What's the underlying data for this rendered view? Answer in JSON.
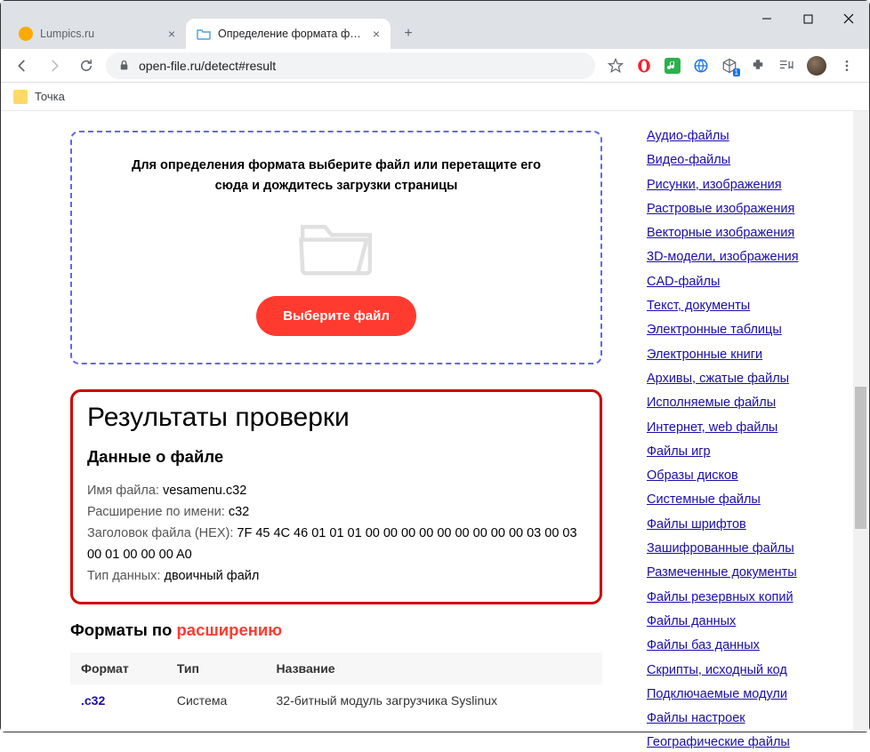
{
  "window": {
    "tabs": [
      {
        "title": "Lumpics.ru",
        "active": false
      },
      {
        "title": "Определение формата файла",
        "active": true
      }
    ],
    "url": "open-file.ru/detect#result"
  },
  "bookmarks": [
    {
      "label": "Точка"
    }
  ],
  "dropzone": {
    "message": "Для определения формата выберите файл или перетащите его сюда и дождитесь загрузки страницы",
    "button": "Выберите файл"
  },
  "results": {
    "heading": "Результаты проверки",
    "subheading": "Данные о файле",
    "rows": {
      "filename_label": "Имя файла: ",
      "filename_value": "vesamenu.c32",
      "ext_label": "Расширение по имени: ",
      "ext_value": "c32",
      "hex_label": "Заголовок файла (HEX): ",
      "hex_value": "7F 45 4C 46 01 01 01 00 00 00 00 00 00 00 00 00 03 00 03 00 01 00 00 00 A0",
      "type_label": "Тип данных: ",
      "type_value": "двоичный файл"
    }
  },
  "formats": {
    "heading_prefix": "Форматы по ",
    "heading_highlight": "расширению",
    "table": {
      "headers": {
        "format": "Формат",
        "type": "Тип",
        "name": "Название"
      },
      "row": {
        "format": ".c32",
        "type": "Система",
        "name": "32-битный модуль загрузчика Syslinux"
      }
    }
  },
  "sidebar_links": [
    "Аудио-файлы",
    "Видео-файлы",
    "Рисунки, изображения",
    "Растровые изображения",
    "Векторные изображения",
    "3D-модели, изображения",
    "CAD-файлы",
    "Текст, документы",
    "Электронные таблицы",
    "Электронные книги",
    "Архивы, сжатые файлы",
    "Исполняемые файлы",
    "Интернет, web файлы",
    "Файлы игр",
    "Образы дисков",
    "Системные файлы",
    "Файлы шрифтов",
    "Зашифрованные файлы",
    "Размеченные документы",
    "Файлы резервных копий",
    "Файлы данных",
    "Файлы баз данных",
    "Скрипты, исходный код",
    "Подключаемые модули",
    "Файлы настроек",
    "Географические файлы"
  ]
}
